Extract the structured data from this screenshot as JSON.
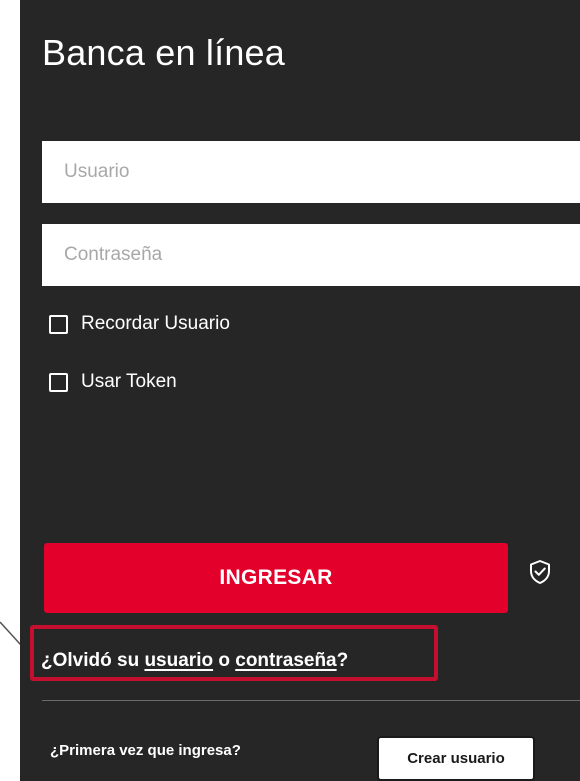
{
  "panel": {
    "title": "Banca en línea"
  },
  "form": {
    "username_placeholder": "Usuario",
    "username_value": "",
    "password_placeholder": "Contraseña",
    "password_value": "",
    "remember_label": "Recordar Usuario",
    "remember_checked": false,
    "token_label": "Usar Token",
    "token_checked": false,
    "submit_label": "INGRESAR",
    "security_icon": "shield-check-icon"
  },
  "recovery": {
    "prefix": "¿Olvidó su ",
    "username_link": "usuario",
    "middle": " o ",
    "password_link": "contraseña",
    "suffix": "?"
  },
  "signup": {
    "prompt": "¿Primera vez que ingresa?",
    "button_label": "Crear usuario"
  },
  "colors": {
    "panel_background": "#262626",
    "primary_red": "#e3002b",
    "highlight_border": "#c4102e"
  }
}
